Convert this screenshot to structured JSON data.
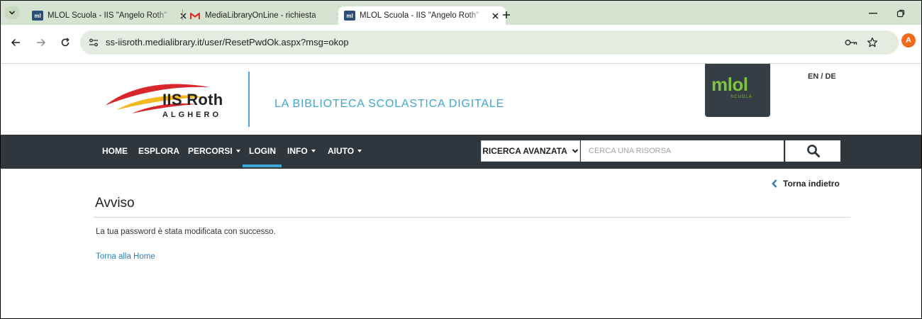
{
  "browser": {
    "tabs": [
      {
        "title": "MLOL Scuola - IIS \"Angelo Roth\"",
        "favicon": "mlol-favicon",
        "active": false
      },
      {
        "title": "MediaLibraryOnLine - richiesta",
        "favicon": "gmail-icon",
        "active": false
      },
      {
        "title": "MLOL Scuola - IIS \"Angelo Roth\"",
        "favicon": "mlol-favicon",
        "active": true
      }
    ],
    "favicon_label": "ml",
    "url": "ss-iisroth.medialibrary.it/user/ResetPwdOk.aspx?msg=okop",
    "profile_initial": "A",
    "colors": {
      "tabstrip": "#d5e4d0",
      "omnibox": "#e4ece1",
      "profile": "#f26b1d"
    }
  },
  "header": {
    "school_name": "IIS Roth",
    "school_city": "ALGHERO",
    "tagline": "LA BIBLIOTECA SCOLASTICA DIGITALE",
    "brand_text": "mlol",
    "brand_sub": "SCUOLA",
    "language_switch": "EN / DE",
    "colors": {
      "tagline": "#3ea6cf",
      "brand_green": "#7cc33e",
      "badge_bg": "#353e45"
    }
  },
  "nav": {
    "items": [
      {
        "label": "HOME",
        "dropdown": false
      },
      {
        "label": "ESPLORA",
        "dropdown": false
      },
      {
        "label": "PERCORSI",
        "dropdown": true
      },
      {
        "label": "LOGIN",
        "dropdown": false,
        "active": true
      },
      {
        "label": "INFO",
        "dropdown": true
      },
      {
        "label": "AIUTO",
        "dropdown": true
      }
    ],
    "advanced_search_label": "RICERCA AVANZATA",
    "search_placeholder": "CERCA UNA RISORSA",
    "colors": {
      "bar": "#2f363c",
      "active_underline": "#3aa7d6"
    }
  },
  "content": {
    "back_label": "Torna indietro",
    "title": "Avviso",
    "message": "La tua password è stata modificata con successo.",
    "home_link": "Torna alla Home",
    "colors": {
      "link": "#2f7fb5"
    }
  }
}
